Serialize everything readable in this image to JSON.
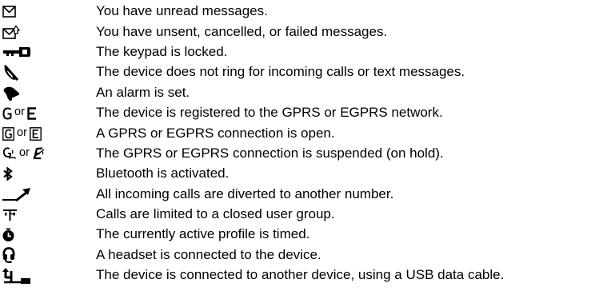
{
  "indicators": [
    {
      "icon": "unread-message-icon",
      "text": "You have unread messages."
    },
    {
      "icon": "unsent-message-icon",
      "text": "You have unsent, cancelled, or failed messages."
    },
    {
      "icon": "keypad-lock-icon",
      "text": "The keypad is locked."
    },
    {
      "icon": "silent-ringer-icon",
      "text": "The device does not ring for incoming calls or text messages."
    },
    {
      "icon": "alarm-bell-icon",
      "text": "An alarm is set."
    },
    {
      "icon": "gprs-egprs-registered-icons",
      "connector": "or",
      "text": "The device is registered to the GPRS or EGPRS network."
    },
    {
      "icon": "gprs-egprs-connection-open-icons",
      "connector": "or",
      "text": "A GPRS or EGPRS connection is open."
    },
    {
      "icon": "gprs-egprs-suspended-icons",
      "connector": "or",
      "text": "The GPRS or EGPRS connection is suspended (on hold)."
    },
    {
      "icon": "bluetooth-icon",
      "text": "Bluetooth is activated."
    },
    {
      "icon": "call-divert-icon",
      "text": "All incoming calls are diverted to another number."
    },
    {
      "icon": "closed-user-group-icon",
      "text": "Calls are limited to a closed user group."
    },
    {
      "icon": "timed-profile-icon",
      "text": "The currently active profile is timed."
    },
    {
      "icon": "headset-icon",
      "text": "A headset is connected to the device."
    },
    {
      "icon": "usb-cable-icon",
      "text": "The device is connected to another device, using a USB data cable."
    }
  ]
}
